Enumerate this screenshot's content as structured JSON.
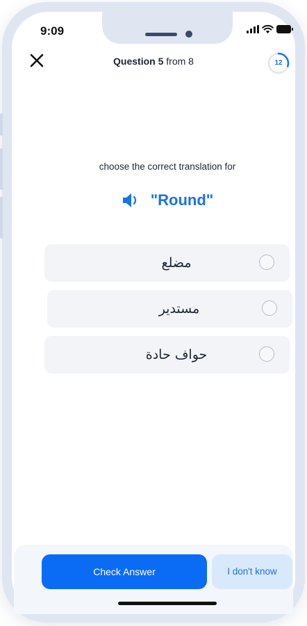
{
  "status_bar": {
    "time": "9:09",
    "icons": [
      "signal-icon",
      "wifi-icon",
      "battery-icon"
    ]
  },
  "header": {
    "close_icon": "close-icon",
    "question_word": "Question 5",
    "question_from": " from 8",
    "timer_value": "12",
    "timer_progress": 0.3
  },
  "prompt": {
    "text": "choose the correct translation for"
  },
  "word": {
    "icon": "speaker-icon",
    "text": "\"Round\""
  },
  "options": [
    {
      "label": "مضلع",
      "selected": false
    },
    {
      "label": "مستدير",
      "selected": false
    },
    {
      "label": "حواف حادة",
      "selected": false
    }
  ],
  "actions": {
    "check_label": "Check Answer",
    "dont_know_label": "I don't know"
  },
  "colors": {
    "accent": "#0a6cf5",
    "accent_text": "#1a73e8",
    "frame": "#dfe6f2",
    "option_bg": "#f2f4f7"
  }
}
